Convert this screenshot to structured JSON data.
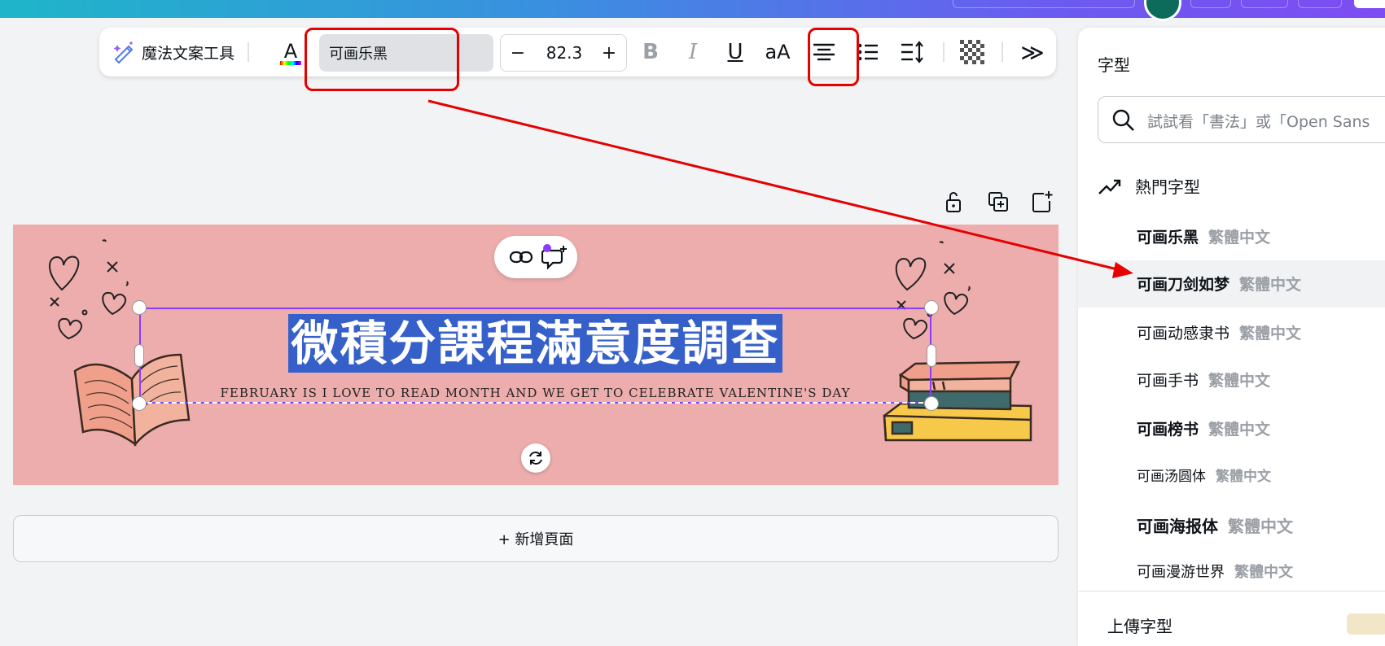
{
  "toolbar": {
    "magic_label": "魔法文案工具",
    "color_letter": "A",
    "font_name": "可画乐黑",
    "font_size": "82.3",
    "size_minus": "−",
    "size_plus": "+",
    "bold": "B",
    "italic": "I",
    "underline": "U",
    "case": "aA",
    "more": "≫"
  },
  "canvas": {
    "title": "微積分課程滿意度調查",
    "subtitle": "FEBRUARY IS I LOVE TO READ MONTH AND WE GET TO CELEBRATE VALENTINE'S DAY",
    "background": "#eeadad",
    "title_highlight": "#3660c9",
    "selection_color": "#8b3dff"
  },
  "add_page_label": "+ 新增頁面",
  "panel": {
    "title": "字型",
    "search_placeholder": "試試看「書法」或「Open Sans",
    "popular_label": "熱門字型",
    "fonts": [
      {
        "name": "可画乐黑",
        "tag": "繁體中文"
      },
      {
        "name": "可画刀剑如梦",
        "tag": "繁體中文"
      },
      {
        "name": "可画动感隶书",
        "tag": "繁體中文"
      },
      {
        "name": "可画手书",
        "tag": "繁體中文"
      },
      {
        "name": "可画榜书",
        "tag": "繁體中文"
      },
      {
        "name": "可画汤圆体",
        "tag": "繁體中文"
      },
      {
        "name": "可画海报体",
        "tag": "繁體中文"
      },
      {
        "name": "可画漫游世界",
        "tag": "繁體中文"
      }
    ],
    "upload_label": "上傳字型"
  },
  "colors": {
    "annotation_red": "#e60000",
    "topbar_start": "#1fb5c9",
    "topbar_end": "#7d4cf2"
  }
}
